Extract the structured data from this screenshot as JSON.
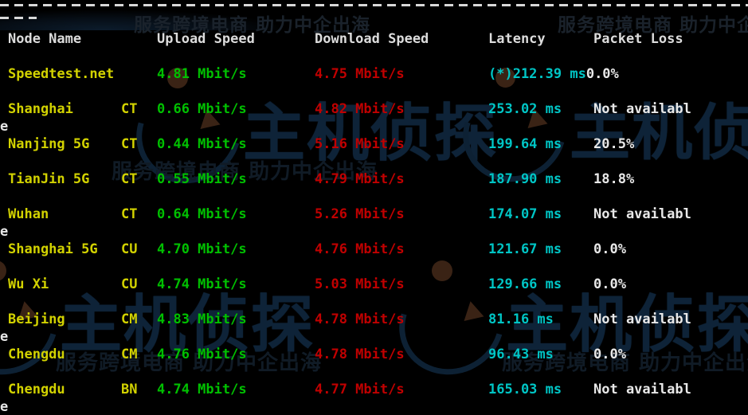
{
  "terminal": {
    "background": "#000000",
    "divider_label": "dashed-separator"
  },
  "watermark": {
    "brand": "主机侦探",
    "tagline": "服务跨境电商 助力中企出海"
  },
  "table": {
    "headers": {
      "node_name": "Node Name",
      "upload_speed": "Upload Speed",
      "download_speed": "Download Speed",
      "latency": "Latency",
      "packet_loss": "Packet Loss"
    },
    "colors": {
      "header": "#dcdcdc",
      "node": "#d2d200",
      "upload": "#00c000",
      "download": "#c00000",
      "latency": "#00c5c5",
      "loss": "#e8e8e8"
    },
    "wrap_char": "e",
    "rows": [
      {
        "node": "Speedtest.net",
        "isp": "",
        "upload": "4.81 Mbit/s",
        "download": "4.75 Mbit/s",
        "latency": "(*)212.39 ms",
        "loss": "0.0%",
        "loss_inline": true,
        "wrapped": false
      },
      {
        "node": "Shanghai",
        "isp": "CT",
        "upload": "0.66 Mbit/s",
        "download": "4.82 Mbit/s",
        "latency": "253.02 ms",
        "loss": "Not availabl",
        "loss_inline": false,
        "wrapped": true
      },
      {
        "node": "Nanjing 5G",
        "isp": "CT",
        "upload": "0.44 Mbit/s",
        "download": "5.16 Mbit/s",
        "latency": "199.64 ms",
        "loss": "20.5%",
        "loss_inline": false,
        "wrapped": false
      },
      {
        "node": "TianJin 5G",
        "isp": "CT",
        "upload": "0.55 Mbit/s",
        "download": "4.79 Mbit/s",
        "latency": "187.90 ms",
        "loss": "18.8%",
        "loss_inline": false,
        "wrapped": false
      },
      {
        "node": "Wuhan",
        "isp": "CT",
        "upload": "0.64 Mbit/s",
        "download": "5.26 Mbit/s",
        "latency": "174.07 ms",
        "loss": "Not availabl",
        "loss_inline": false,
        "wrapped": true
      },
      {
        "node": "Shanghai 5G",
        "isp": "CU",
        "upload": "4.70 Mbit/s",
        "download": "4.76 Mbit/s",
        "latency": "121.67 ms",
        "loss": "0.0%",
        "loss_inline": false,
        "wrapped": false
      },
      {
        "node": "Wu Xi",
        "isp": "CU",
        "upload": "4.74 Mbit/s",
        "download": "5.03 Mbit/s",
        "latency": "129.66 ms",
        "loss": "0.0%",
        "loss_inline": false,
        "wrapped": false
      },
      {
        "node": "Beijing",
        "isp": "CM",
        "upload": "4.83 Mbit/s",
        "download": "4.78 Mbit/s",
        "latency": "81.16 ms",
        "loss": "Not availabl",
        "loss_inline": false,
        "wrapped": true
      },
      {
        "node": "Chengdu",
        "isp": "CM",
        "upload": "4.76 Mbit/s",
        "download": "4.78 Mbit/s",
        "latency": "96.43 ms",
        "loss": "0.0%",
        "loss_inline": false,
        "wrapped": false
      },
      {
        "node": "Chengdu",
        "isp": "BN",
        "upload": "4.74 Mbit/s",
        "download": "4.77 Mbit/s",
        "latency": "165.03 ms",
        "loss": "Not availabl",
        "loss_inline": false,
        "wrapped": true
      }
    ]
  }
}
